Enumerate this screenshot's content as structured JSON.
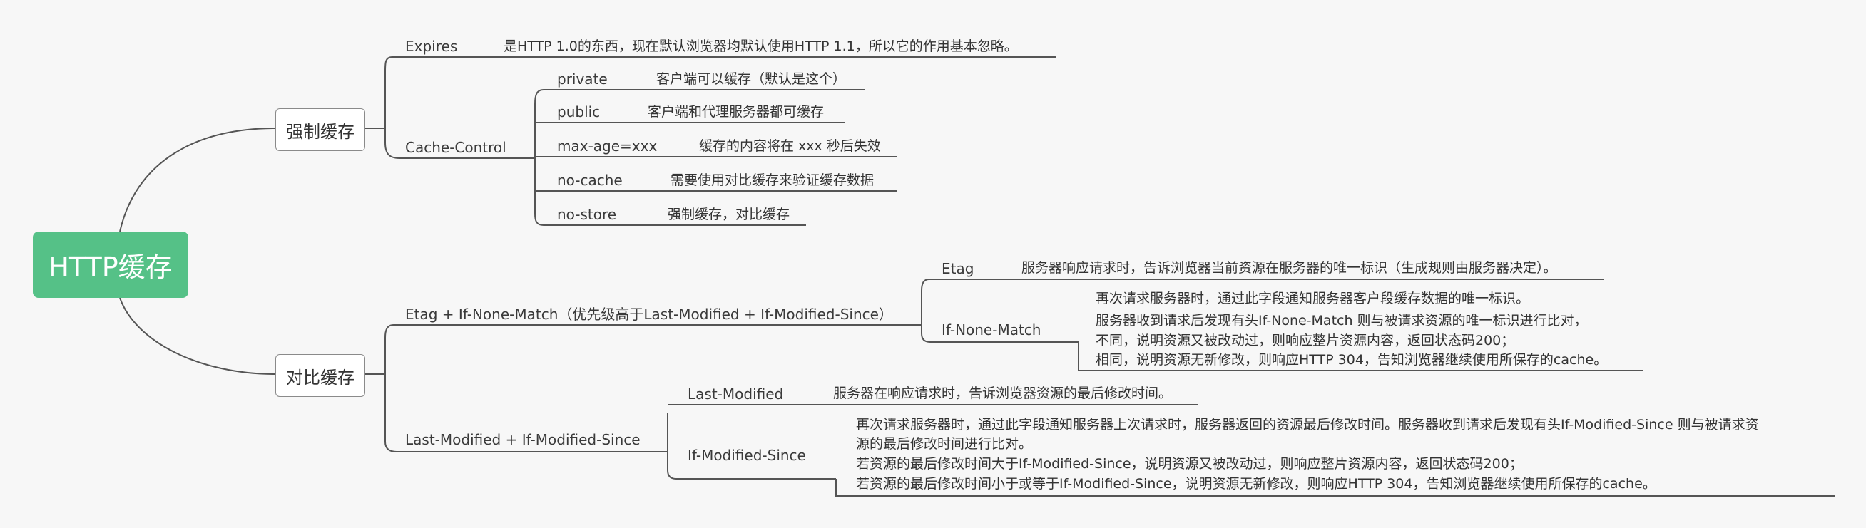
{
  "root": {
    "label": "HTTP缓存"
  },
  "strong": {
    "label": "强制缓存",
    "expires": {
      "label": "Expires",
      "desc": "是HTTP 1.0的东西，现在默认浏览器均默认使用HTTP 1.1，所以它的作用基本忽略。"
    },
    "cache_control": {
      "label": "Cache-Control",
      "items": [
        {
          "label": "private",
          "desc": "客户端可以缓存（默认是这个）"
        },
        {
          "label": "public",
          "desc": "客户端和代理服务器都可缓存"
        },
        {
          "label": "max-age=xxx",
          "desc": "缓存的内容将在 xxx 秒后失效"
        },
        {
          "label": "no-cache",
          "desc": "需要使用对比缓存来验证缓存数据"
        },
        {
          "label": "no-store",
          "desc": "强制缓存，对比缓存"
        }
      ]
    }
  },
  "compare": {
    "label": "对比缓存",
    "etag_group": {
      "label": "Etag + If-None-Match（优先级高于Last-Modified + If-Modified-Since）",
      "etag": {
        "label": "Etag",
        "desc": "服务器响应请求时，告诉浏览器当前资源在服务器的唯一标识（生成规则由服务器决定）。"
      },
      "if_none_match": {
        "label": "If-None-Match",
        "lines": [
          "再次请求服务器时，通过此字段通知服务器客户段缓存数据的唯一标识。",
          "服务器收到请求后发现有头If-None-Match 则与被请求资源的唯一标识进行比对，",
          "不同，说明资源又被改动过，则响应整片资源内容，返回状态码200；",
          "相同，说明资源无新修改，则响应HTTP 304，告知浏览器继续使用所保存的cache。"
        ]
      }
    },
    "lm_group": {
      "label": "Last-Modified + If-Modified-Since",
      "last_modified": {
        "label": "Last-Modified",
        "desc": "服务器在响应请求时，告诉浏览器资源的最后修改时间。"
      },
      "if_modified_since": {
        "label": "If-Modified-Since",
        "lines": [
          "再次请求服务器时，通过此字段通知服务器上次请求时，服务器返回的资源最后修改时间。服务器收到请求后发现有头If-Modified-Since 则与被请求资",
          "源的最后修改时间进行比对。",
          "若资源的最后修改时间大于If-Modified-Since，说明资源又被改动过，则响应整片资源内容，返回状态码200；",
          "若资源的最后修改时间小于或等于If-Modified-Since，说明资源无新修改，则响应HTTP 304，告知浏览器继续使用所保存的cache。"
        ]
      }
    }
  },
  "colors": {
    "root_fill": "#55c187",
    "line": "#555555",
    "background": "#f7f7f7"
  }
}
